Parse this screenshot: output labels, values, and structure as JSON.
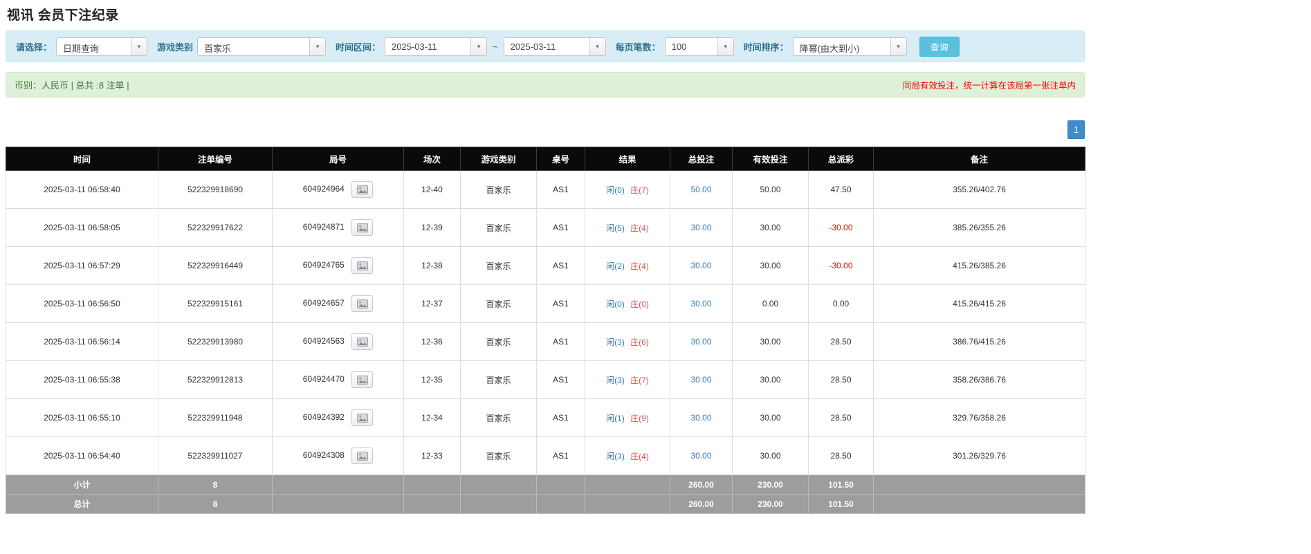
{
  "page_title": "视讯 会员下注纪录",
  "filters": {
    "select_label": "请选择：",
    "select_value": "日期查询",
    "game_type_label": "游戏类别",
    "game_type_value": "百家乐",
    "time_range_label": "时间区间：",
    "date_from": "2025-03-11",
    "range_separator": "~",
    "date_to": "2025-03-11",
    "page_size_label": "每页笔数：",
    "page_size_value": "100",
    "sort_label": "时间排序：",
    "sort_value": "降幂(由大到小)",
    "search_button": "查询"
  },
  "summary": {
    "left": "币别：人民币 | 总共 :8 注单 |",
    "right": "同局有效投注，统一计算在该局第一张注单内"
  },
  "pagination": {
    "current_page": "1"
  },
  "icons": {
    "caret": "▼",
    "round_media": "image-icon"
  },
  "colors": {
    "accent": "#5bc0de",
    "link": "#337ab7",
    "player_blue": "#337ab7",
    "banker_red": "#d9534f",
    "negative_red": "#e60000",
    "warning_red": "#ff0000",
    "header_bg": "#0a0a0a",
    "footer_bg": "#9d9d9d",
    "filter_bg": "#d9edf7",
    "summary_bg": "#dff0d8",
    "summary_text": "#3c763d"
  },
  "table": {
    "headers": [
      "时间",
      "注单编号",
      "局号",
      "场次",
      "游戏类别",
      "桌号",
      "结果",
      "总投注",
      "有效投注",
      "总派彩",
      "备注"
    ],
    "rows": [
      {
        "time": "2025-03-11 06:58:40",
        "bet_id": "522329918690",
        "round_id": "604924964",
        "session": "12-40",
        "game": "百家乐",
        "table_no": "AS1",
        "player": "闲(0)",
        "banker": "庄(7)",
        "total_bet": "50.00",
        "valid_bet": "50.00",
        "payout": "47.50",
        "note": "355.26/402.76"
      },
      {
        "time": "2025-03-11 06:58:05",
        "bet_id": "522329917622",
        "round_id": "604924871",
        "session": "12-39",
        "game": "百家乐",
        "table_no": "AS1",
        "player": "闲(5)",
        "banker": "庄(4)",
        "total_bet": "30.00",
        "valid_bet": "30.00",
        "payout": "-30.00",
        "note": "385.26/355.26"
      },
      {
        "time": "2025-03-11 06:57:29",
        "bet_id": "522329916449",
        "round_id": "604924765",
        "session": "12-38",
        "game": "百家乐",
        "table_no": "AS1",
        "player": "闲(2)",
        "banker": "庄(4)",
        "total_bet": "30.00",
        "valid_bet": "30.00",
        "payout": "-30.00",
        "note": "415.26/385.26"
      },
      {
        "time": "2025-03-11 06:56:50",
        "bet_id": "522329915161",
        "round_id": "604924657",
        "session": "12-37",
        "game": "百家乐",
        "table_no": "AS1",
        "player": "闲(0)",
        "banker": "庄(0)",
        "total_bet": "30.00",
        "valid_bet": "0.00",
        "payout": "0.00",
        "note": "415.26/415.26"
      },
      {
        "time": "2025-03-11 06:56:14",
        "bet_id": "522329913980",
        "round_id": "604924563",
        "session": "12-36",
        "game": "百家乐",
        "table_no": "AS1",
        "player": "闲(3)",
        "banker": "庄(6)",
        "total_bet": "30.00",
        "valid_bet": "30.00",
        "payout": "28.50",
        "note": "386.76/415.26"
      },
      {
        "time": "2025-03-11 06:55:38",
        "bet_id": "522329912813",
        "round_id": "604924470",
        "session": "12-35",
        "game": "百家乐",
        "table_no": "AS1",
        "player": "闲(3)",
        "banker": "庄(7)",
        "total_bet": "30.00",
        "valid_bet": "30.00",
        "payout": "28.50",
        "note": "358.26/386.76"
      },
      {
        "time": "2025-03-11 06:55:10",
        "bet_id": "522329911948",
        "round_id": "604924392",
        "session": "12-34",
        "game": "百家乐",
        "table_no": "AS1",
        "player": "闲(1)",
        "banker": "庄(9)",
        "total_bet": "30.00",
        "valid_bet": "30.00",
        "payout": "28.50",
        "note": "329.76/358.26"
      },
      {
        "time": "2025-03-11 06:54:40",
        "bet_id": "522329911027",
        "round_id": "604924308",
        "session": "12-33",
        "game": "百家乐",
        "table_no": "AS1",
        "player": "闲(3)",
        "banker": "庄(4)",
        "total_bet": "30.00",
        "valid_bet": "30.00",
        "payout": "28.50",
        "note": "301.26/329.76"
      }
    ],
    "subtotal": {
      "label": "小计",
      "count": "8",
      "total_bet": "260.00",
      "valid_bet": "230.00",
      "payout": "101.50"
    },
    "grand_total": {
      "label": "总计",
      "count": "8",
      "total_bet": "260.00",
      "valid_bet": "230.00",
      "payout": "101.50"
    }
  }
}
